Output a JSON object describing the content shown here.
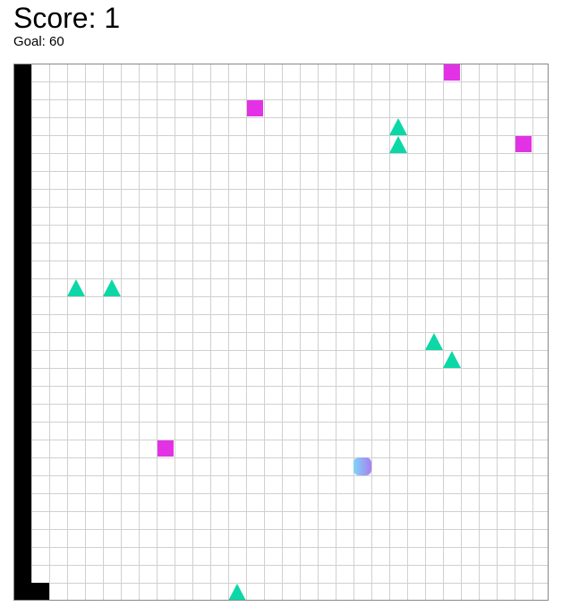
{
  "hud": {
    "score_label": "Score: 1",
    "goal_label": "Goal: 60"
  },
  "board": {
    "cols": 30,
    "rows": 30,
    "colors": {
      "wall": "#000000",
      "square": "#e332e6",
      "triangle": "#0bd8a6",
      "player_gradient_start": "#7fd6f7",
      "player_gradient_end": "#a77ff0",
      "grid_line": "#d0d0d0"
    },
    "walls": [
      {
        "col": 0,
        "row": 0
      },
      {
        "col": 0,
        "row": 1
      },
      {
        "col": 0,
        "row": 2
      },
      {
        "col": 0,
        "row": 3
      },
      {
        "col": 0,
        "row": 4
      },
      {
        "col": 0,
        "row": 5
      },
      {
        "col": 0,
        "row": 6
      },
      {
        "col": 0,
        "row": 7
      },
      {
        "col": 0,
        "row": 8
      },
      {
        "col": 0,
        "row": 9
      },
      {
        "col": 0,
        "row": 10
      },
      {
        "col": 0,
        "row": 11
      },
      {
        "col": 0,
        "row": 12
      },
      {
        "col": 0,
        "row": 13
      },
      {
        "col": 0,
        "row": 14
      },
      {
        "col": 0,
        "row": 15
      },
      {
        "col": 0,
        "row": 16
      },
      {
        "col": 0,
        "row": 17
      },
      {
        "col": 0,
        "row": 18
      },
      {
        "col": 0,
        "row": 19
      },
      {
        "col": 0,
        "row": 20
      },
      {
        "col": 0,
        "row": 21
      },
      {
        "col": 0,
        "row": 22
      },
      {
        "col": 0,
        "row": 23
      },
      {
        "col": 0,
        "row": 24
      },
      {
        "col": 0,
        "row": 25
      },
      {
        "col": 0,
        "row": 26
      },
      {
        "col": 0,
        "row": 27
      },
      {
        "col": 0,
        "row": 28
      },
      {
        "col": 0,
        "row": 29
      },
      {
        "col": 1,
        "row": 29
      }
    ],
    "squares": [
      {
        "col": 24,
        "row": 0
      },
      {
        "col": 13,
        "row": 2
      },
      {
        "col": 28,
        "row": 4
      },
      {
        "col": 8,
        "row": 21
      }
    ],
    "triangles": [
      {
        "col": 21,
        "row": 3
      },
      {
        "col": 21,
        "row": 4
      },
      {
        "col": 3,
        "row": 12
      },
      {
        "col": 5,
        "row": 12
      },
      {
        "col": 23,
        "row": 15
      },
      {
        "col": 24,
        "row": 16
      },
      {
        "col": 12,
        "row": 29
      }
    ],
    "player": {
      "col": 19,
      "row": 22
    }
  }
}
